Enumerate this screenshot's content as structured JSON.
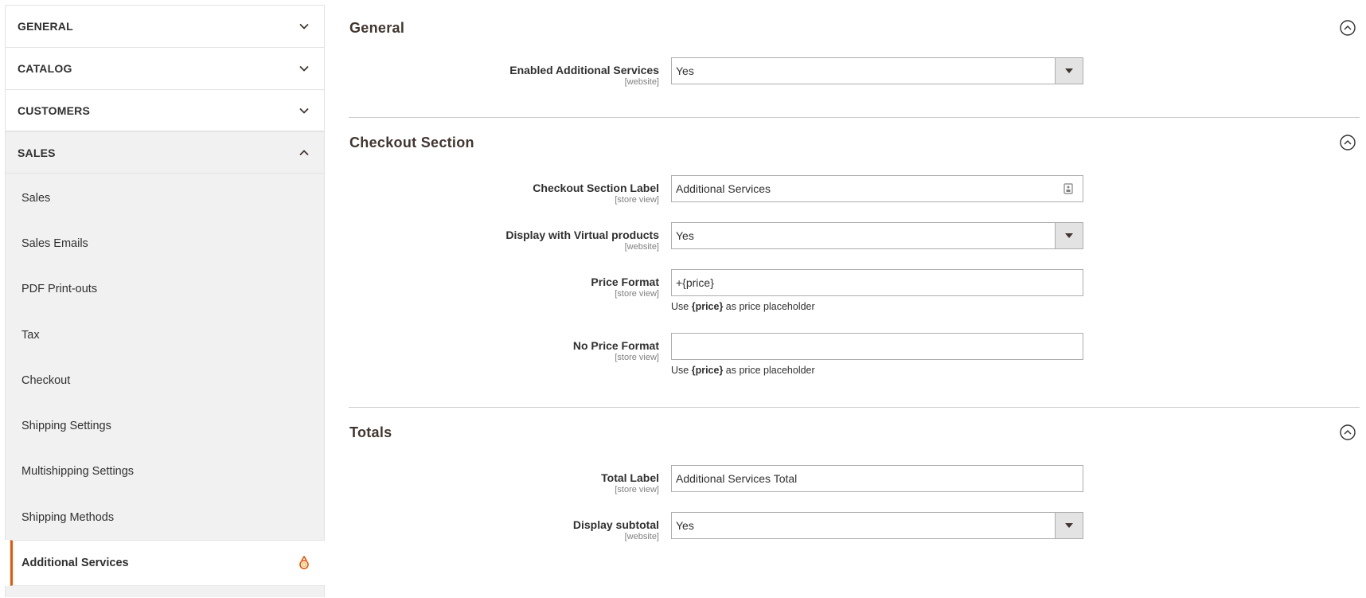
{
  "sidebar": {
    "tabs": [
      {
        "label": "GENERAL",
        "expanded": false
      },
      {
        "label": "CATALOG",
        "expanded": false
      },
      {
        "label": "CUSTOMERS",
        "expanded": false
      },
      {
        "label": "SALES",
        "expanded": true
      }
    ],
    "sales_items": [
      "Sales",
      "Sales Emails",
      "PDF Print-outs",
      "Tax",
      "Checkout",
      "Shipping Settings",
      "Multishipping Settings",
      "Shipping Methods"
    ],
    "active_item": "Additional Services",
    "active_item_icon": "extension-icon"
  },
  "sections": {
    "general": {
      "title": "General",
      "enabled": {
        "label": "Enabled Additional Services",
        "scope": "[website]",
        "value": "Yes"
      }
    },
    "checkout": {
      "title": "Checkout Section",
      "section_label": {
        "label": "Checkout Section Label",
        "scope": "[store view]",
        "value": "Additional Services"
      },
      "display_virtual": {
        "label": "Display with Virtual products",
        "scope": "[website]",
        "value": "Yes"
      },
      "price_format": {
        "label": "Price Format",
        "scope": "[store view]",
        "value": "+{price}",
        "note_pre": "Use ",
        "note_bold": "{price}",
        "note_post": " as price placeholder"
      },
      "no_price_format": {
        "label": "No Price Format",
        "scope": "[store view]",
        "value": "",
        "note_pre": "Use ",
        "note_bold": "{price}",
        "note_post": " as price placeholder"
      }
    },
    "totals": {
      "title": "Totals",
      "total_label": {
        "label": "Total Label",
        "scope": "[store view]",
        "value": "Additional Services Total"
      },
      "display_subtotal": {
        "label": "Display subtotal",
        "scope": "[website]",
        "value": "Yes"
      }
    }
  },
  "colors": {
    "accent": "#eb5202",
    "sidebar_bg": "#f1f1f1",
    "border": "#adadad"
  }
}
